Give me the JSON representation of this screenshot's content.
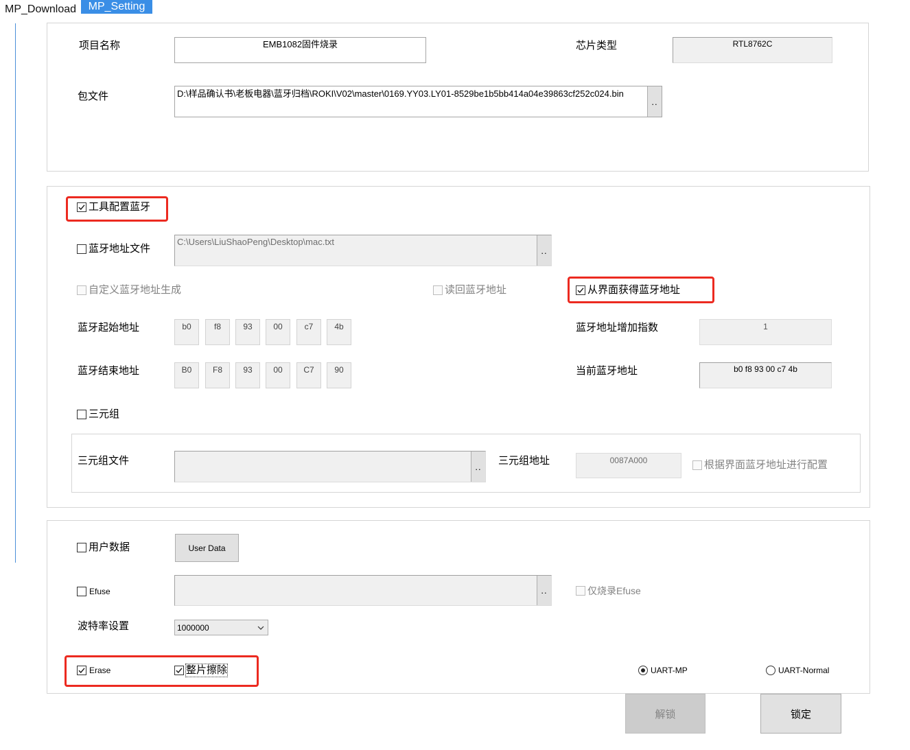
{
  "colors": {
    "tab_active": "#3a8ee6",
    "highlight": "#ec2a20",
    "accent_line": "#4a8fd9"
  },
  "tabs": [
    {
      "label": "MP_Download",
      "active": false
    },
    {
      "label": "MP_Setting",
      "active": true
    }
  ],
  "project": {
    "name_label": "项目名称",
    "name_value": "EMB1082固件烧录",
    "chip_label": "芯片类型",
    "chip_value": "RTL8762C",
    "package_label": "包文件",
    "package_value": "D:\\样品确认书\\老板电器\\蓝牙归档\\ROKI\\V02\\master\\0169.YY03.LY01-8529be1b5bb414a04e39863cf252c024.bin",
    "browse_label": ".."
  },
  "bluetooth": {
    "tool_config": {
      "label": "工具配置蓝牙",
      "checked": true,
      "enabled": true
    },
    "address_file": {
      "label": "蓝牙地址文件",
      "checked": false,
      "enabled": true,
      "path": "C:\\Users\\LiuShaoPeng\\Desktop\\mac.txt",
      "browse_label": ".."
    },
    "custom_generate": {
      "label": "自定义蓝牙地址生成",
      "checked": false,
      "enabled": false
    },
    "read_back": {
      "label": "读回蓝牙地址",
      "checked": false,
      "enabled": false
    },
    "from_ui": {
      "label": "从界面获得蓝牙地址",
      "checked": true,
      "enabled": true
    },
    "start_label": "蓝牙起始地址",
    "start_bytes": [
      "b0",
      "f8",
      "93",
      "00",
      "c7",
      "4b"
    ],
    "end_label": "蓝牙结束地址",
    "end_bytes": [
      "B0",
      "F8",
      "93",
      "00",
      "C7",
      "90"
    ],
    "increment_label": "蓝牙地址增加指数",
    "increment_value": "1",
    "current_label": "当前蓝牙地址",
    "current_value": "b0 f8 93 00 c7 4b"
  },
  "triple": {
    "checkbox": {
      "label": "三元组",
      "checked": false,
      "enabled": true
    },
    "file_label": "三元组文件",
    "browse_label": "..",
    "address_label": "三元组地址",
    "address_value": "0087A000",
    "config_by_ui": {
      "label": "根据界面蓝牙地址进行配置",
      "checked": false,
      "enabled": false
    }
  },
  "other": {
    "user_data": {
      "label": "用户数据",
      "checked": false,
      "enabled": true,
      "button_label": "User Data"
    },
    "efuse": {
      "label": "Efuse",
      "checked": false,
      "enabled": true,
      "browse_label": ".."
    },
    "efuse_only": {
      "label": "仅烧录Efuse",
      "checked": false,
      "enabled": false
    },
    "baud_label": "波特率设置",
    "baud_value": "1000000",
    "erase": {
      "label": "Erase",
      "checked": true,
      "enabled": true
    },
    "chip_erase": {
      "label": "整片擦除",
      "checked": true,
      "enabled": true
    },
    "mode_options": [
      {
        "label": "UART-MP",
        "selected": true
      },
      {
        "label": "UART-Normal",
        "selected": false
      }
    ]
  },
  "actions": {
    "unlock": {
      "label": "解锁",
      "enabled": false
    },
    "lock": {
      "label": "锁定",
      "enabled": true
    }
  }
}
